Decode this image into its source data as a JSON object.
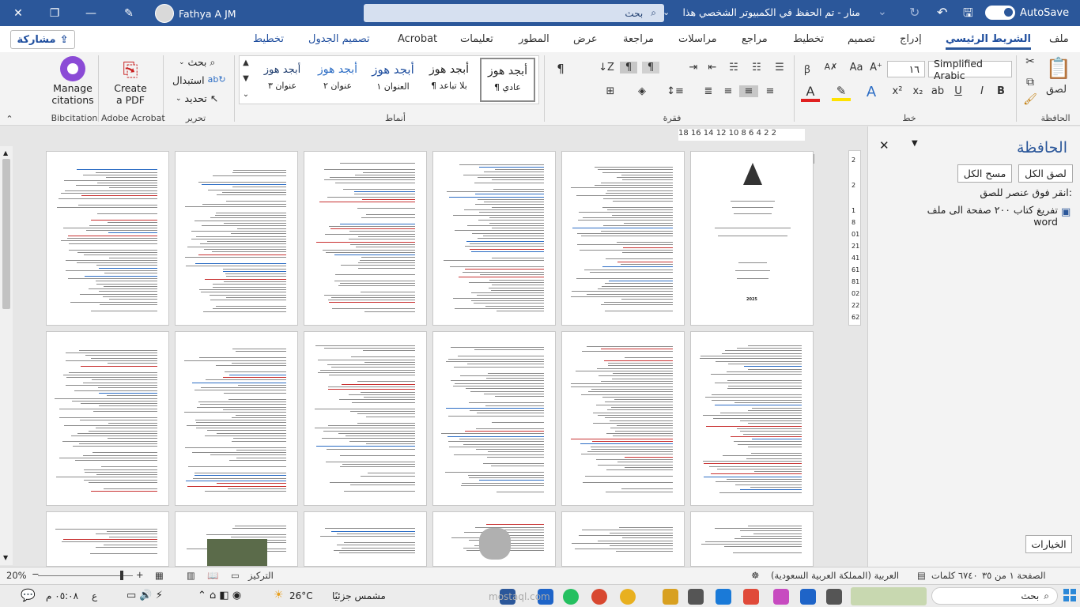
{
  "titlebar": {
    "autosave_label": "AutoSave",
    "doc_title": "منار - تم الحفظ في الكمبيوتر الشخصي هذا",
    "search_placeholder": "بحث",
    "user_name": "Fathya A JM"
  },
  "tabs": [
    "ملف",
    "الشريط الرئيسي",
    "إدراج",
    "تصميم",
    "تخطيط",
    "مراجع",
    "مراسلات",
    "مراجعة",
    "عرض",
    "المطور",
    "تعليمات",
    "Acrobat",
    "تصميم الجدول",
    "تخطيط"
  ],
  "active_tab": "الشريط الرئيسي",
  "share_label": "مشاركة",
  "ribbon": {
    "clipboard": {
      "paste": "لصق",
      "group": "الحافظة"
    },
    "font": {
      "name": "Simplified Arabic",
      "size": "١٦",
      "group": "خط",
      "bold": "B",
      "italic": "I",
      "underline": "U",
      "aa": "Aa"
    },
    "paragraph": {
      "group": "فقرة"
    },
    "styles": {
      "group": "أنماط",
      "items": [
        {
          "preview": "أبجد هوز",
          "name": "¶ عادي"
        },
        {
          "preview": "أبجد هوز",
          "name": "¶ بلا تباعد"
        },
        {
          "preview": "أبجد هوز",
          "name": "العنوان ١"
        },
        {
          "preview": "أبجد هوز",
          "name": "عنوان ٢"
        },
        {
          "preview": "أبجد هوز",
          "name": "عنوان ٣"
        }
      ]
    },
    "editing": {
      "find": "بحث",
      "replace": "استبدال",
      "select": "تحديد",
      "group": "تحرير"
    },
    "acrobat": {
      "create_pdf_1": "Create",
      "create_pdf_2": "a PDF",
      "group": "Adobe Acrobat"
    },
    "bibcitation": {
      "manage_1": "Manage",
      "manage_2": "citations",
      "group": "Bibcitation"
    }
  },
  "clipboard_pane": {
    "title": "الحافظة",
    "paste_all": "لصق الكل",
    "clear_all": "مسح الكل",
    "instruction": "انقر فوق عنصر للصق:",
    "item": "تفريغ كتاب ٢٠٠ صفحة الى ملف word",
    "options": "الخيارات"
  },
  "ruler": {
    "h": "18 16 14 12 10 8 6 4 2 2",
    "v": [
      "2",
      "2",
      "1",
      "8",
      "01",
      "21",
      "41",
      "61",
      "81",
      "02",
      "22",
      "62"
    ]
  },
  "status": {
    "page": "الصفحة ١ من ٣٥",
    "words": "٦٧٤٠ كلمات",
    "language": "العربية (المملكة العربية السعودية)",
    "focus": "التركيز",
    "zoom": "20%"
  },
  "taskbar": {
    "search": "بحث",
    "weather_temp": "26°C",
    "weather_desc": "مشمس جزئيًا",
    "time": "٠٥:٠٨ م",
    "lang": "ع",
    "watermark": "mostaql.com"
  },
  "doc_pages": {
    "cover_lines": [
      "عنوان البحث: تكنولوجيا الروبوتات",
      "2025"
    ]
  }
}
